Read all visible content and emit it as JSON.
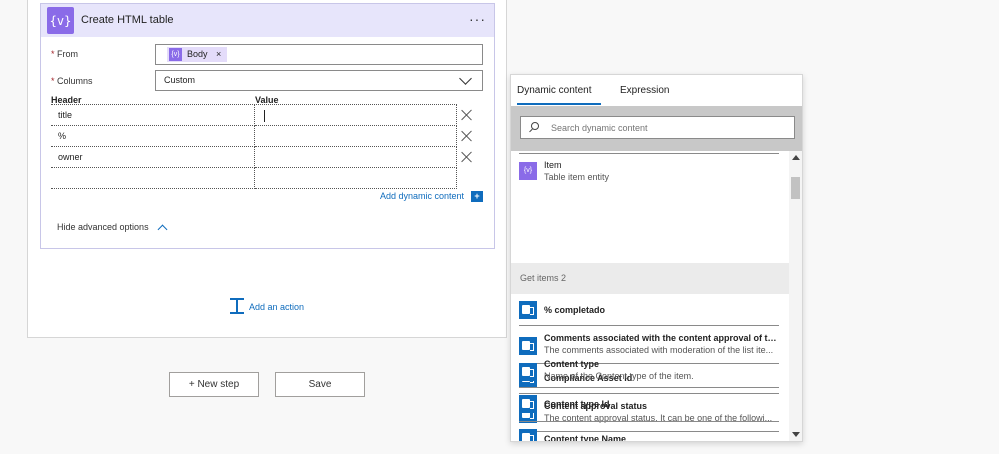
{
  "action_card": {
    "title": "Create HTML table",
    "icon": "variable-icon",
    "icon_glyph": "{v}",
    "more_glyph": "···",
    "from_label": "From",
    "from_token": {
      "label": "Body",
      "icon_glyph": "{v}",
      "remove_glyph": "×"
    },
    "columns_label": "Columns",
    "columns_value": "Custom",
    "header_col": "Header",
    "value_col": "Value",
    "rows": [
      {
        "header": "title",
        "value": ""
      },
      {
        "header": "%",
        "value": ""
      },
      {
        "header": "owner",
        "value": ""
      },
      {
        "header": "",
        "value": ""
      }
    ],
    "add_dynamic_content": "Add dynamic content",
    "add_dynamic_icon": "+",
    "hide_advanced": "Hide advanced options",
    "accent": "#8a6be8"
  },
  "add_action": "Add an action",
  "buttons": {
    "new_step": "+ New step",
    "save": "Save"
  },
  "dynamic_panel": {
    "tabs": [
      "Dynamic content",
      "Expression"
    ],
    "active_tab": "Dynamic content",
    "search_placeholder": "Search dynamic content",
    "top_item": {
      "title": "Item",
      "desc": "Table item entity",
      "icon": "variable-icon",
      "icon_glyph": "{v}"
    },
    "group_header": "Get items 2",
    "items": [
      {
        "title": "% completado",
        "desc": ""
      },
      {
        "title": "Comments associated with the content approval of thi...",
        "desc": "The comments associated with moderation of the list ite..."
      },
      {
        "title": "Compliance Asset Id",
        "desc": ""
      },
      {
        "title": "Content approval status",
        "desc": "The content approval status. It can be one of the followi..."
      },
      {
        "title": "Content type",
        "desc": "Name of the Content type of the item."
      },
      {
        "title": "Content type Id",
        "desc": ""
      },
      {
        "title": "Content type Name",
        "desc": ""
      }
    ],
    "item_icon": "sharepoint-icon",
    "link_color": "#0f6cbd"
  }
}
